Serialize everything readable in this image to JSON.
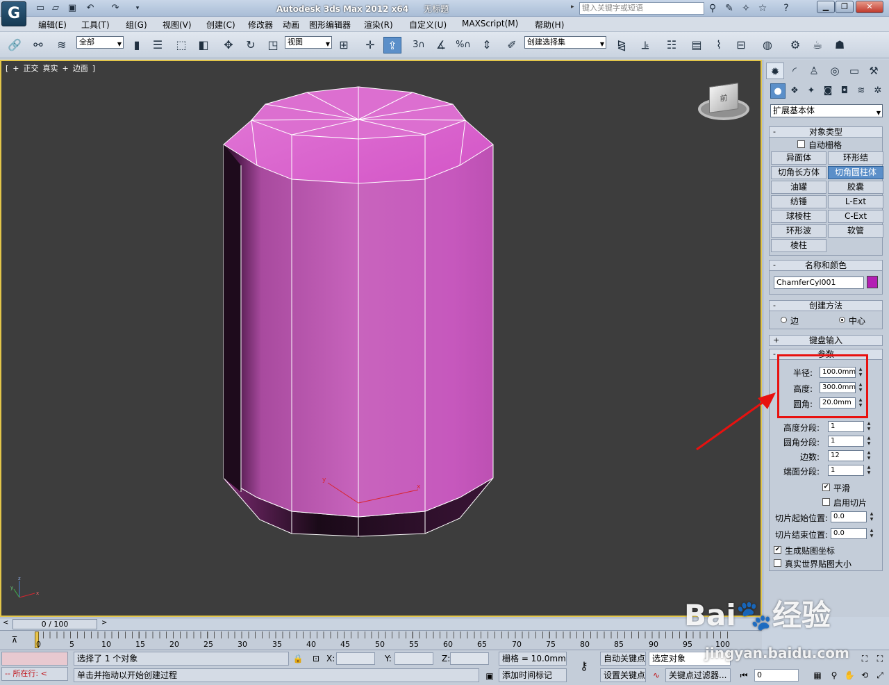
{
  "title": {
    "app": "Autodesk 3ds Max  2012 x64",
    "doc": "无标题",
    "search_placeholder": "键入关键字或短语"
  },
  "menu": [
    "编辑(E)",
    "工具(T)",
    "组(G)",
    "视图(V)",
    "创建(C)",
    "修改器",
    "动画",
    "图形编辑器",
    "渲染(R)",
    "自定义(U)",
    "MAXScript(M)",
    "帮助(H)"
  ],
  "toolbar": {
    "filter_value": "全部",
    "refcoord_value": "视图",
    "named_selection": "创建选择集",
    "snap_3": "3",
    "angle_snap": "%"
  },
  "viewport": {
    "label": [
      "+",
      "正交",
      "真实",
      "边面"
    ],
    "viewcube_face": "前",
    "axis_x": "x",
    "axis_y": "y",
    "axis_z": "z",
    "accent_color": "#e3c64a"
  },
  "panel": {
    "category": "扩展基本体",
    "object_type": {
      "title": "对象类型",
      "autogrid": "自动栅格",
      "buttons": [
        "异面体",
        "环形结",
        "切角长方体",
        "切角圆柱体",
        "油罐",
        "胶囊",
        "纺锤",
        "L-Ext",
        "球棱柱",
        "C-Ext",
        "环形波",
        "软管",
        "棱柱"
      ],
      "active_button": "切角圆柱体"
    },
    "name_color": {
      "title": "名称和颜色",
      "name": "ChamferCyl001",
      "color": "#b31fb4"
    },
    "creation_method": {
      "title": "创建方法",
      "edge": "边",
      "center": "中心",
      "selected": "center"
    },
    "keyboard_entry": {
      "title": "键盘输入",
      "sign": "+"
    },
    "parameters": {
      "title": "参数",
      "sign": "-",
      "radius_label": "半径:",
      "radius": "100.0mm",
      "height_label": "高度:",
      "height": "300.0mm",
      "fillet_label": "圆角:",
      "fillet": "20.0mm",
      "height_segs_label": "高度分段:",
      "height_segs": "1",
      "fillet_segs_label": "圆角分段:",
      "fillet_segs": "1",
      "sides_label": "边数:",
      "sides": "12",
      "cap_segs_label": "端面分段:",
      "cap_segs": "1",
      "smooth_label": "平滑",
      "slice_on_label": "启用切片",
      "slice_from_label": "切片起始位置:",
      "slice_from": "0.0",
      "slice_to_label": "切片结束位置:",
      "slice_to": "0.0",
      "gen_map_label": "生成贴图坐标",
      "real_world_label": "真实世界贴图大小"
    },
    "collapse_sign": "-"
  },
  "timeline": {
    "frame": "0 / 100",
    "ticks": [
      "0",
      "5",
      "10",
      "15",
      "20",
      "25",
      "30",
      "35",
      "40",
      "45",
      "50",
      "55",
      "60",
      "65",
      "70",
      "75",
      "80",
      "85",
      "90",
      "95",
      "100"
    ]
  },
  "status": {
    "selected": "选择了 1 个对象",
    "prompt": "单击并拖动以开始创建过程",
    "running": "所在行:",
    "x_label": "X:",
    "y_label": "Y:",
    "z_label": "Z:",
    "grid": "栅格 = 10.0mm",
    "add_time_tag": "添加时间标记",
    "auto_key": "自动关键点",
    "set_key": "设置关键点",
    "selected_object": "选定对象",
    "key_filters": "关键点过滤器...",
    "frame_input": "0"
  },
  "watermark": {
    "brand": "Bai",
    "brand_tail": "经验",
    "url": "jingyan.baidu.com"
  }
}
